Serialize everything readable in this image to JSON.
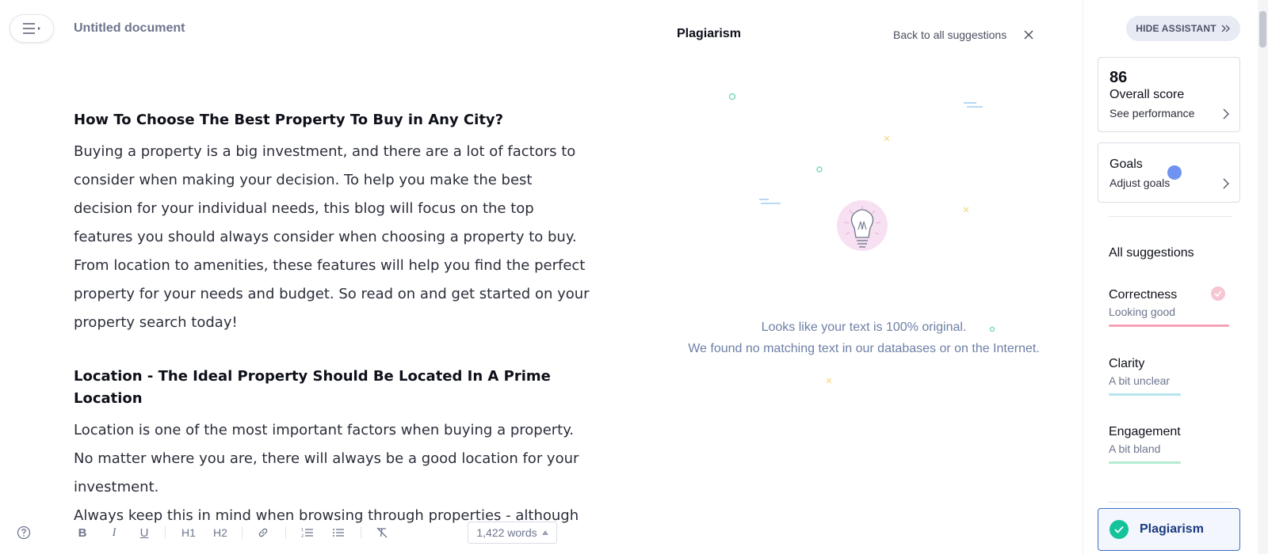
{
  "document": {
    "title": "Untitled document",
    "blocks": [
      {
        "type": "heading",
        "text": "How To Choose The Best Property To Buy in Any City?"
      },
      {
        "type": "paragraph",
        "lines": [
          "Buying a property is a big investment, and there are a lot of factors to",
          "consider when making your decision. To help you make the best",
          "decision for your individual needs, this blog will focus on the top",
          "features you should always consider when choosing a property to buy.",
          "From location to amenities, these features will help you find the perfect",
          "property for your needs and budget. So read on and get started on your",
          "property search today!"
        ]
      },
      {
        "type": "heading",
        "text": "Location - The Ideal Property Should Be Located In A Prime Location"
      },
      {
        "type": "paragraph",
        "lines": [
          "Location is one of the most important factors when buying a property.",
          "No matter where you are, there will always be a good location for your",
          "investment."
        ]
      },
      {
        "type": "paragraph",
        "lines": [
          "Always keep this in mind when browsing through properties - although"
        ]
      }
    ]
  },
  "toolbar": {
    "bold": "B",
    "italic": "I",
    "underline": "U",
    "h1": "H1",
    "h2": "H2",
    "word_count": "1,422 words"
  },
  "plagiarism": {
    "title": "Plagiarism",
    "back_link": "Back to all suggestions",
    "message_line1": "Looks like your text is 100% original.",
    "message_line2": "We found no matching text in our databases or on the Internet."
  },
  "assistant": {
    "hide_label": "HIDE ASSISTANT",
    "score": "86",
    "score_label": "Overall score",
    "score_link": "See performance",
    "goals_label": "Goals",
    "goals_link": "Adjust goals",
    "all_suggestions": "All suggestions",
    "categories": [
      {
        "name": "Correctness",
        "status": "Looking good",
        "color": "#f7a1b5",
        "fill": 1.0
      },
      {
        "name": "Clarity",
        "status": "A bit unclear",
        "color": "#b6e4ef",
        "fill": 0.6
      },
      {
        "name": "Engagement",
        "status": "A bit bland",
        "color": "#b4ebd3",
        "fill": 0.6
      }
    ],
    "plagiarism_button": "Plagiarism"
  },
  "colors": {
    "accent": "#15c39a",
    "link_blue": "#3d6fc6",
    "message_text": "#6d7fa6"
  }
}
